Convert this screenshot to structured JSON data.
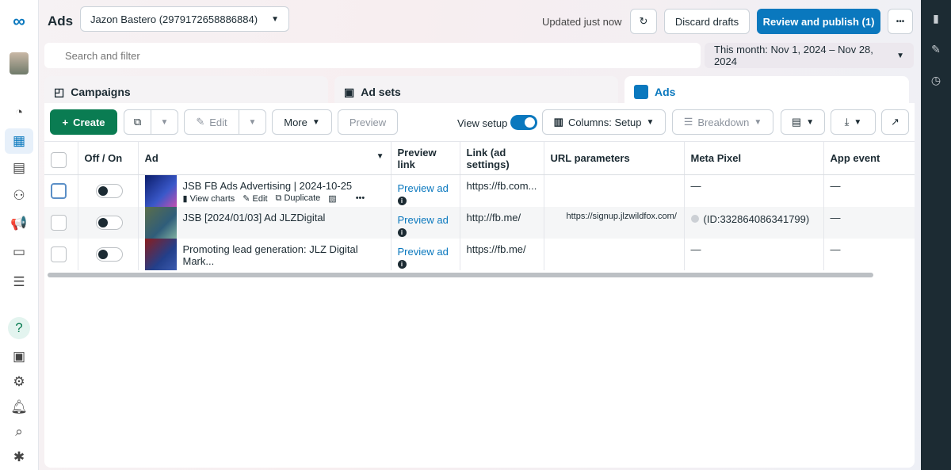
{
  "header": {
    "title": "Ads",
    "account": "Jazon Bastero (2979172658886884)",
    "status": "Updated just now",
    "discard": "Discard drafts",
    "publish": "Review and publish (1)",
    "more": "•••"
  },
  "search": {
    "placeholder": "Search and filter"
  },
  "date_range": "This month: Nov 1, 2024 – Nov 28, 2024",
  "tabs": [
    {
      "label": "Campaigns"
    },
    {
      "label": "Ad sets"
    },
    {
      "label": "Ads"
    }
  ],
  "toolbar": {
    "create": "Create",
    "edit": "Edit",
    "more": "More",
    "preview": "Preview",
    "view_setup": "View setup",
    "view_setup_on": true,
    "columns": "Columns: Setup",
    "breakdown": "Breakdown"
  },
  "table": {
    "headers": [
      "Off / On",
      "Ad",
      "Preview link",
      "Link (ad settings)",
      "URL parameters",
      "Meta Pixel",
      "App event"
    ],
    "row_actions": {
      "view_charts": "View charts",
      "edit": "Edit",
      "duplicate": "Duplicate",
      "more": "•••"
    },
    "rows": [
      {
        "name": "JSB FB Ads Advertising | 2024-10-25",
        "preview": "Preview ad",
        "link": "https://fb.com...",
        "url_params": "",
        "pixel": "—",
        "app_event": "—"
      },
      {
        "name": "JSB [2024/01/03] Ad JLZDigital",
        "preview": "Preview ad",
        "link": "http://fb.me/",
        "url_params": "https://signup.jlzwildfox.com/",
        "pixel": "(ID:332864086341799)",
        "app_event": "—"
      },
      {
        "name": "Promoting lead generation: JLZ Digital Mark...",
        "preview": "Preview ad",
        "link": "https://fb.me/",
        "url_params": "",
        "pixel": "—",
        "app_event": "—"
      }
    ]
  },
  "colors": {
    "accent": "#0a78be",
    "create": "#0a7c52",
    "dark_panel": "#1c2b33"
  }
}
